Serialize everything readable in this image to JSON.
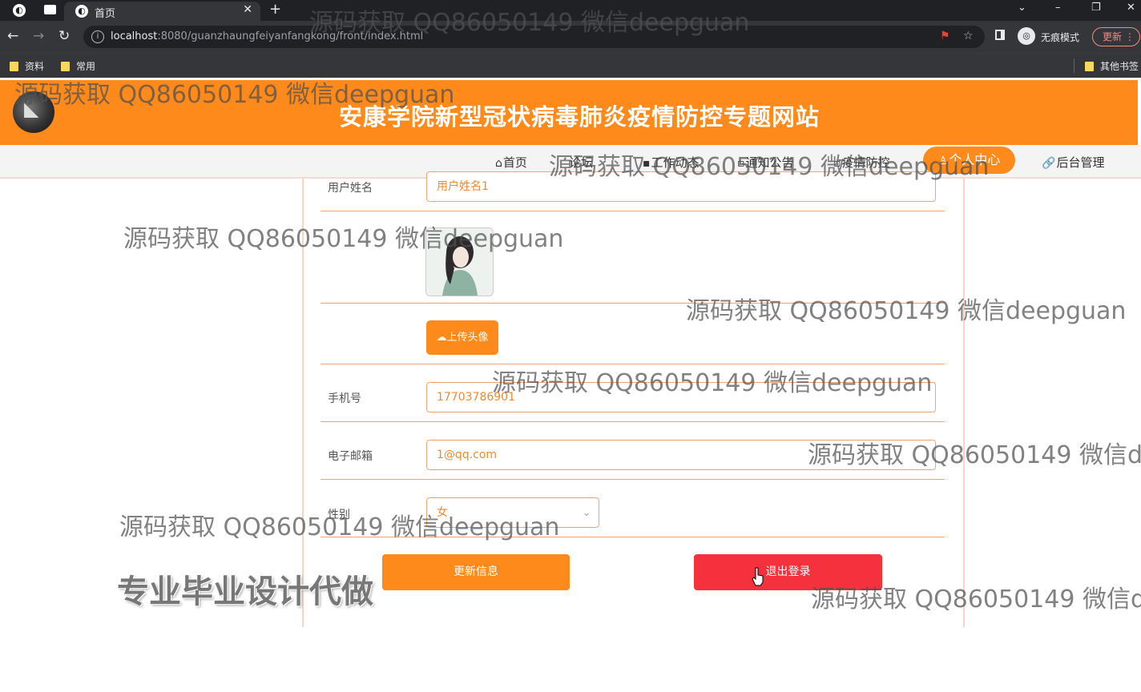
{
  "browser": {
    "tab_title": "首页",
    "url_host": "localhost",
    "url_path": ":8080/guanzhaungfeiyanfangkong/front/index.html",
    "incognito_label": "无痕模式",
    "update_label": "更新",
    "bookmarks": [
      "资料",
      "常用"
    ],
    "other_bookmarks": "其他书签"
  },
  "site": {
    "title": "安康学院新型冠状病毒肺炎疫情防控专题网站",
    "nav": {
      "home": "首页",
      "forum": "论坛",
      "work": "工作动态",
      "notice": "通知公告",
      "epidemic": "疫情防控",
      "personal_center": "个人中心",
      "admin": "后台管理"
    }
  },
  "form": {
    "name_label": "用户姓名",
    "name_value": "用户姓名1",
    "upload_label": "上传头像",
    "phone_label": "手机号",
    "phone_value": "17703786901",
    "email_label": "电子邮箱",
    "email_value": "1@qq.com",
    "gender_label": "性别",
    "gender_value": "女",
    "update_button": "更新信息",
    "logout_button": "退出登录"
  },
  "watermarks": {
    "text": "源码获取 QQ86050149 微信deepguan",
    "promo": "专业毕业设计代做"
  },
  "colors": {
    "brand_orange": "#fd8a1a",
    "logout_red": "#f5313d",
    "input_border": "#f7a273"
  }
}
